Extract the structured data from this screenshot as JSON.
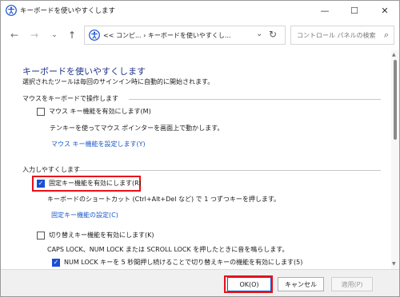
{
  "window": {
    "title": "キーボードを使いやすくします",
    "minimize_glyph": "—",
    "maximize_glyph": "☐",
    "close_glyph": "✕"
  },
  "nav": {
    "back_glyph": "←",
    "forward_glyph": "→",
    "down_glyph": "⌄",
    "up_glyph": "↑",
    "address_text": "<< コンピ...  ›  キーボードを使いやすくし...",
    "address_chevron": "⌄",
    "refresh_glyph": "↻",
    "search_placeholder": "コントロール パネルの検索",
    "search_glyph": "⌕"
  },
  "page": {
    "title": "キーボードを使いやすくします",
    "subtitle": "選択されたツールは毎回のサインイン時に自動的に開始されます。"
  },
  "mouse_section": {
    "header": "マウスをキーボードで操作します",
    "mousekeys_label": "マウス キー機能を有効にします(M)",
    "mousekeys_checked": false,
    "mousekeys_desc": "テンキーを使ってマウス ポインターを画面上で動かします。",
    "mousekeys_link": "マウス キー機能を設定します(Y)"
  },
  "input_section": {
    "header": "入力しやすくします",
    "stickykeys_label": "固定キー機能を有効にします(R)",
    "stickykeys_checked": true,
    "stickykeys_desc": "キーボードのショートカット (Ctrl+Alt+Del など) で 1 つずつキーを押します。",
    "stickykeys_link": "固定キー機能の設定(C)",
    "togglekeys_label": "切り替えキー機能を有効にします(K)",
    "togglekeys_checked": false,
    "togglekeys_desc": "CAPS LOCK、NUM LOCK または SCROLL LOCK を押したときに音を鳴らします。",
    "numlock_label": "NUM LOCK キーを 5 秒間押し続けることで切り替えキーの機能を有効にします(5)",
    "numlock_checked": true
  },
  "footer": {
    "ok_label": "OK(O)",
    "cancel_label": "キャンセル",
    "apply_label": "適用(P)"
  },
  "colors": {
    "title_blue": "#1e3287",
    "link_blue": "#1a58c8",
    "highlight_red": "#e8101a",
    "checkbox_blue": "#1a4fd1"
  },
  "icons": {
    "app": "ease-of-access-icon",
    "address": "ease-of-access-icon",
    "search": "search-icon",
    "refresh": "refresh-icon"
  }
}
